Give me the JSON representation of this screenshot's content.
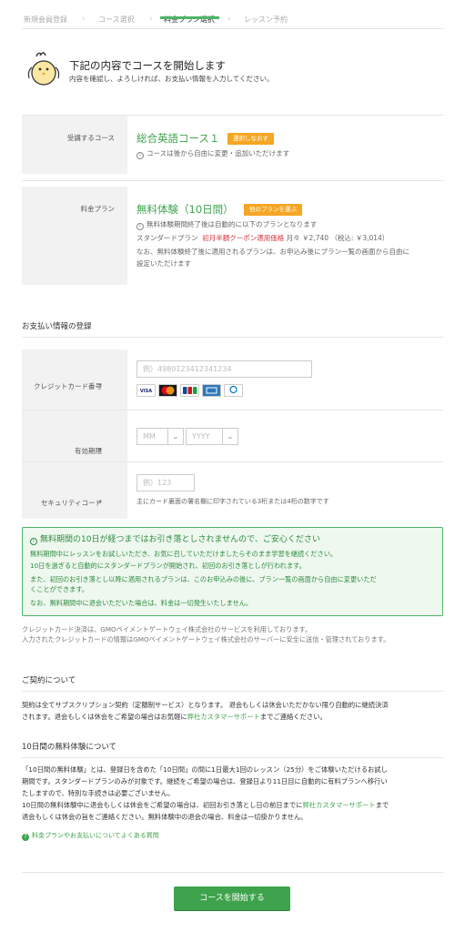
{
  "steps": [
    {
      "label": "新規会員登録",
      "active": false
    },
    {
      "label": "コース選択",
      "active": false
    },
    {
      "label": "料金プラン選択",
      "active": true
    },
    {
      "label": "レッスン予約",
      "active": false
    }
  ],
  "intro": {
    "title": "下記の内容でコースを開始します",
    "subtitle": "内容を確認し、よろしければ、お支払い情報を入力してください。"
  },
  "course": {
    "label": "受講するコース",
    "name": "総合英語コース１",
    "change_button": "選択しなおす",
    "note": "コースは後から自由に変更・追加いただけます"
  },
  "plan": {
    "label": "料金プラン",
    "name": "無料体験（10日間）",
    "change_button": "他のプランを選ぶ",
    "note1": "無料体験期間終了後は自動的に以下のプランとなります",
    "standard_prefix": "スタンダードプラン",
    "coupon": "初月半額クーポン適用価格",
    "price": "月々 ￥2,740 （税込: ￥3,014）",
    "note2_line1": "なお、無料体験終了後に適用されるプランは、お申込み後にプラン一覧の画面から自由に",
    "note2_line2": "設定いただけます"
  },
  "payment": {
    "section_title": "お支払い情報の登録",
    "card_label": "クレジットカード番号",
    "card_placeholder": "例）4980123412341234",
    "card_brands": [
      "VISA",
      "MasterCard",
      "JCB",
      "AMEX",
      "Diners Club"
    ],
    "expiry_label": "有効期限",
    "month_placeholder": "MM",
    "year_placeholder": "YYYY",
    "security_label": "セキュリティコード",
    "security_placeholder": "例）123",
    "security_hint": "主にカード裏面の署名欄に印字されている3桁または4桁の数字です",
    "required_mark": "*"
  },
  "notice": {
    "title": "無料期間の10日が経つまではお引き落としされませんので、ご安心ください",
    "lines": [
      "無料期間中にレッスンをお試しいただき、お気に召していただけましたらそのまま学習を継続ください。",
      "10日を過ぎると自動的にスタンダードプランが開始され、初回のお引き落としが行われます。",
      "また、初回のお引き落とし以降に適用されるプランは、このお申込みの後に、プラン一覧の画面から自由に変更いただ",
      "くことができます。",
      "なお、無料期間中に退会いただいた場合は、料金は一切発生いたしません。"
    ]
  },
  "gmo": {
    "line1": "クレジットカード決済は、GMOペイメントゲートウェイ株式会社のサービスを利用しております。",
    "line2": "入力されたクレジットカードの情報はGMOペイメントゲートウェイ株式会社のサーバーに安全に送信・管理されております。"
  },
  "contract": {
    "title": "ご契約について",
    "line1": "契約は全てサブスクリプション契約（定額制サービス）となります。 退会もしくは休会いただかない限り自動的に継続決済",
    "line2_prefix": "されます。退会もしくは休会をご希望の場合はお気軽に",
    "line2_link": "弊社カスタマーサポート",
    "line2_suffix": "までご連絡ください。"
  },
  "trial": {
    "title": "10日間の無料体験について",
    "line1": "「10日間の無料体験」とは、登録日を含めた「10日間」の間に1日最大1回のレッスン（25分）をご体験いただけるお試し",
    "line2": "期間です。スタンダードプランのみが対象です。継続をご希望の場合は、登録日より11日目に自動的に有料プランへ移行い",
    "line3": "たしますので、特別な手続きは必要ございません。",
    "line4_prefix": "10日間の無料体験中に退会もしくは休会をご希望の場合は、初回お引き落とし日の前日までに",
    "line4_link": "弊社カスタマーサポート",
    "line4_suffix": "まで",
    "line5": "退会もしくは休会の旨をご連絡ください。無料体験中の退会の場合、料金は一切掛かりません。"
  },
  "faq_link": "料金プランやお支払いについてよくある質問",
  "start_button": "コースを開始する",
  "colors": {
    "accent": "#3fa34d",
    "tag": "#f5a623",
    "required": "#e23b3b",
    "coupon": "#d0343a"
  }
}
